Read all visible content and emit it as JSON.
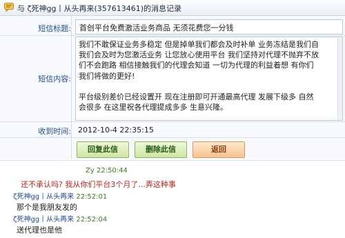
{
  "window": {
    "icon": "chat-bubble-icon",
    "title": "与 ζ死神gg丨从头再来(357613461)的消息记录"
  },
  "sms": {
    "subject_label": "短信标题:",
    "subject_value": "首创平台免费激活业务商品 无须花费您一分钱",
    "content_label": "短信内容:",
    "content_value": "我们不敢保证业务多稳定 但是掉单我们都会及时补单 业务冻结是我们自\n我们会及时为您激活业务 让您放心使用平台 我们坚持对代理不抛弃不放\n们不会跑路 相信接触我们的代理会知道 一切为代理的利益着想 有你们\n我们将做的更好!\n\n平台级别差价已经设置开 现在注册即可开通最高代理 发展下级多 自然\n会很多 在这里祝各代理提成多多 生意兴隆。",
    "time_label": "收到时间:",
    "time_value": "2012-10-4 22:35:15"
  },
  "buttons": {
    "reply": "回复此信",
    "delete": "删除此信",
    "back": "返回"
  },
  "chat": {
    "messages": [
      {
        "sender": "Zy",
        "time": "22:50:44",
        "text": "还不承认吗? 我从你们平台3个月了...弄这种事"
      },
      {
        "sender": "ζ死神gg丨从头再来",
        "time": "22:52:01",
        "text": "那个是我朋友发的"
      },
      {
        "sender": "ζ死神gg丨从头再来",
        "time": "22:52:04",
        "text": "送代理也是他"
      }
    ]
  },
  "colors": {
    "label_blue": "#1f4e8a",
    "sender_green": "#3a7a23",
    "sender_blue": "#1d4c8c",
    "message_red": "#b2281e"
  }
}
